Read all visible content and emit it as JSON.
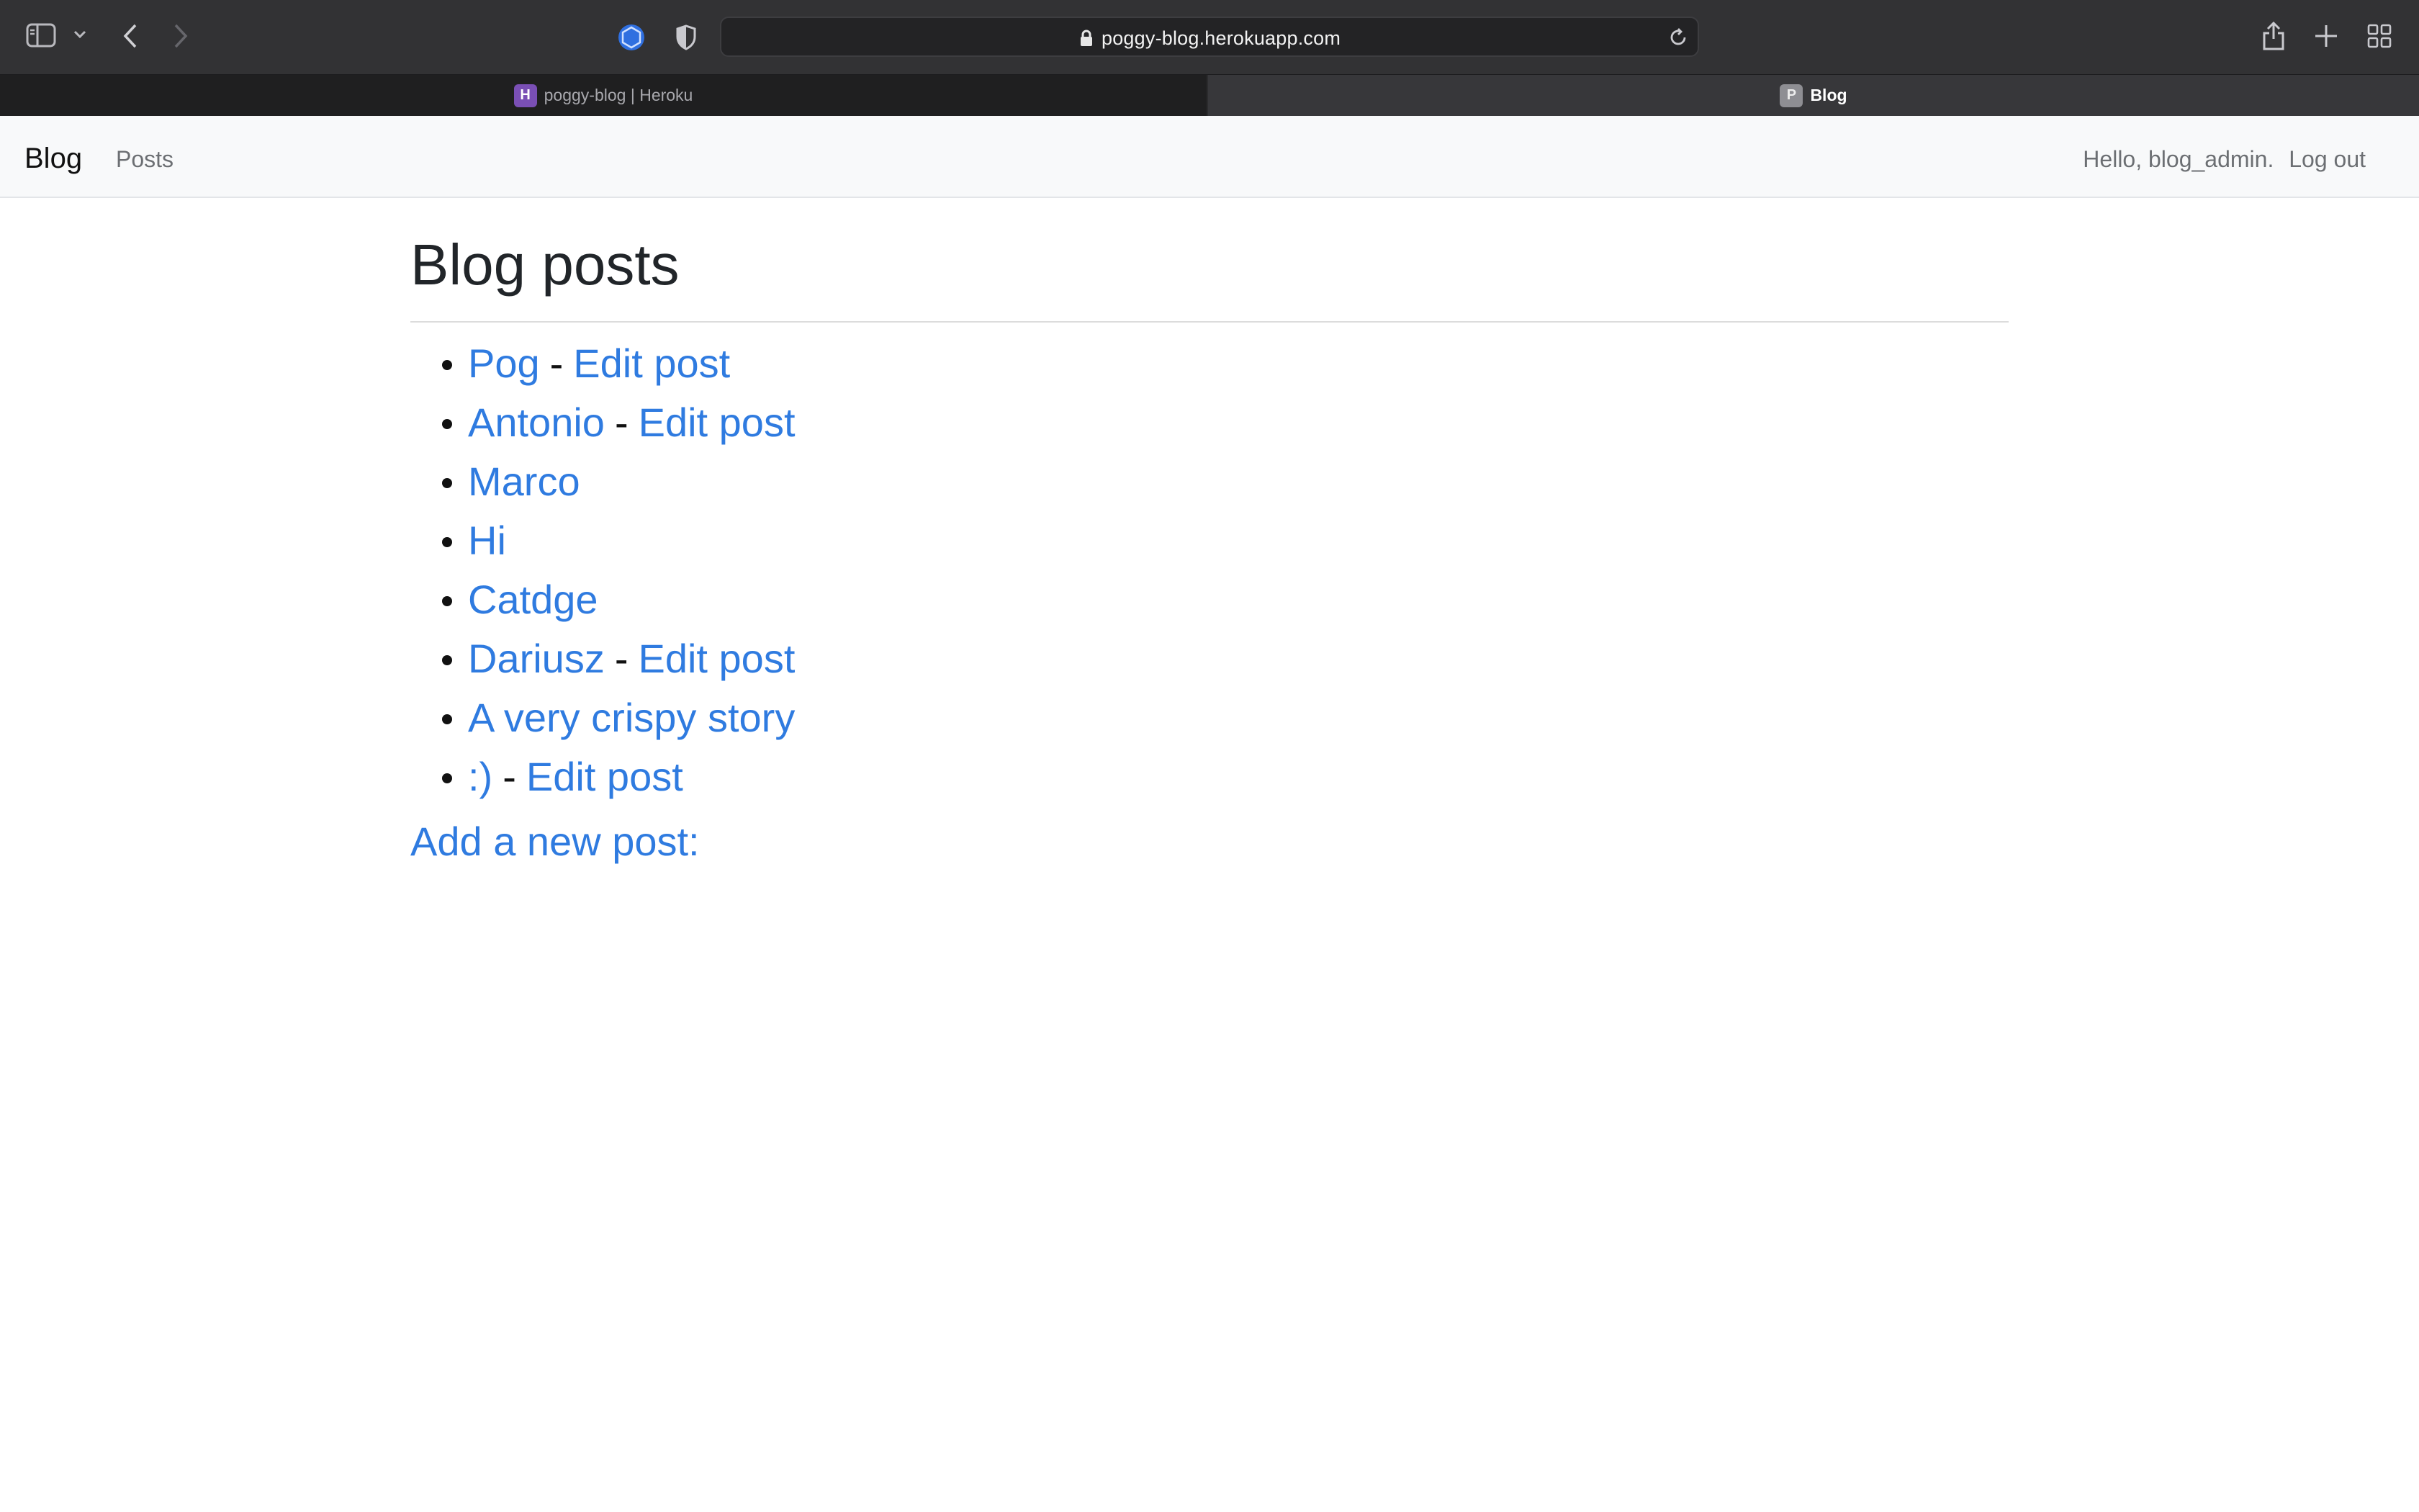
{
  "browser": {
    "url": "poggy-blog.herokuapp.com",
    "tabs": [
      {
        "label": "poggy-blog | Heroku",
        "favicon": "H",
        "active": false
      },
      {
        "label": "Blog",
        "favicon": "P",
        "active": true
      }
    ],
    "icons": {
      "sidebar": "sidebar-icon",
      "back": "chevron-left-icon",
      "forward": "chevron-right-icon",
      "extension": "extension-icon",
      "privacy": "shield-icon",
      "lock": "lock-icon",
      "reload": "reload-icon",
      "share": "share-icon",
      "new_tab": "plus-icon",
      "tab_overview": "grid-icon"
    }
  },
  "navbar": {
    "brand": "Blog",
    "posts_link": "Posts",
    "greeting": "Hello, blog_admin.",
    "logout": "Log out"
  },
  "main": {
    "title": "Blog posts",
    "posts": [
      {
        "title": "Pog",
        "edit": "Edit post"
      },
      {
        "title": "Antonio",
        "edit": "Edit post"
      },
      {
        "title": "Marco",
        "edit": null
      },
      {
        "title": "Hi",
        "edit": null
      },
      {
        "title": "Catdge",
        "edit": null
      },
      {
        "title": "Dariusz",
        "edit": "Edit post"
      },
      {
        "title": "A very crispy story",
        "edit": null
      },
      {
        "title": ":)",
        "edit": "Edit post"
      }
    ],
    "separator": "-",
    "add_post": "Add a new post:"
  },
  "colors": {
    "link": "#2f7be0",
    "toolbar": "#323234",
    "navbar": "#f8f9fa"
  }
}
